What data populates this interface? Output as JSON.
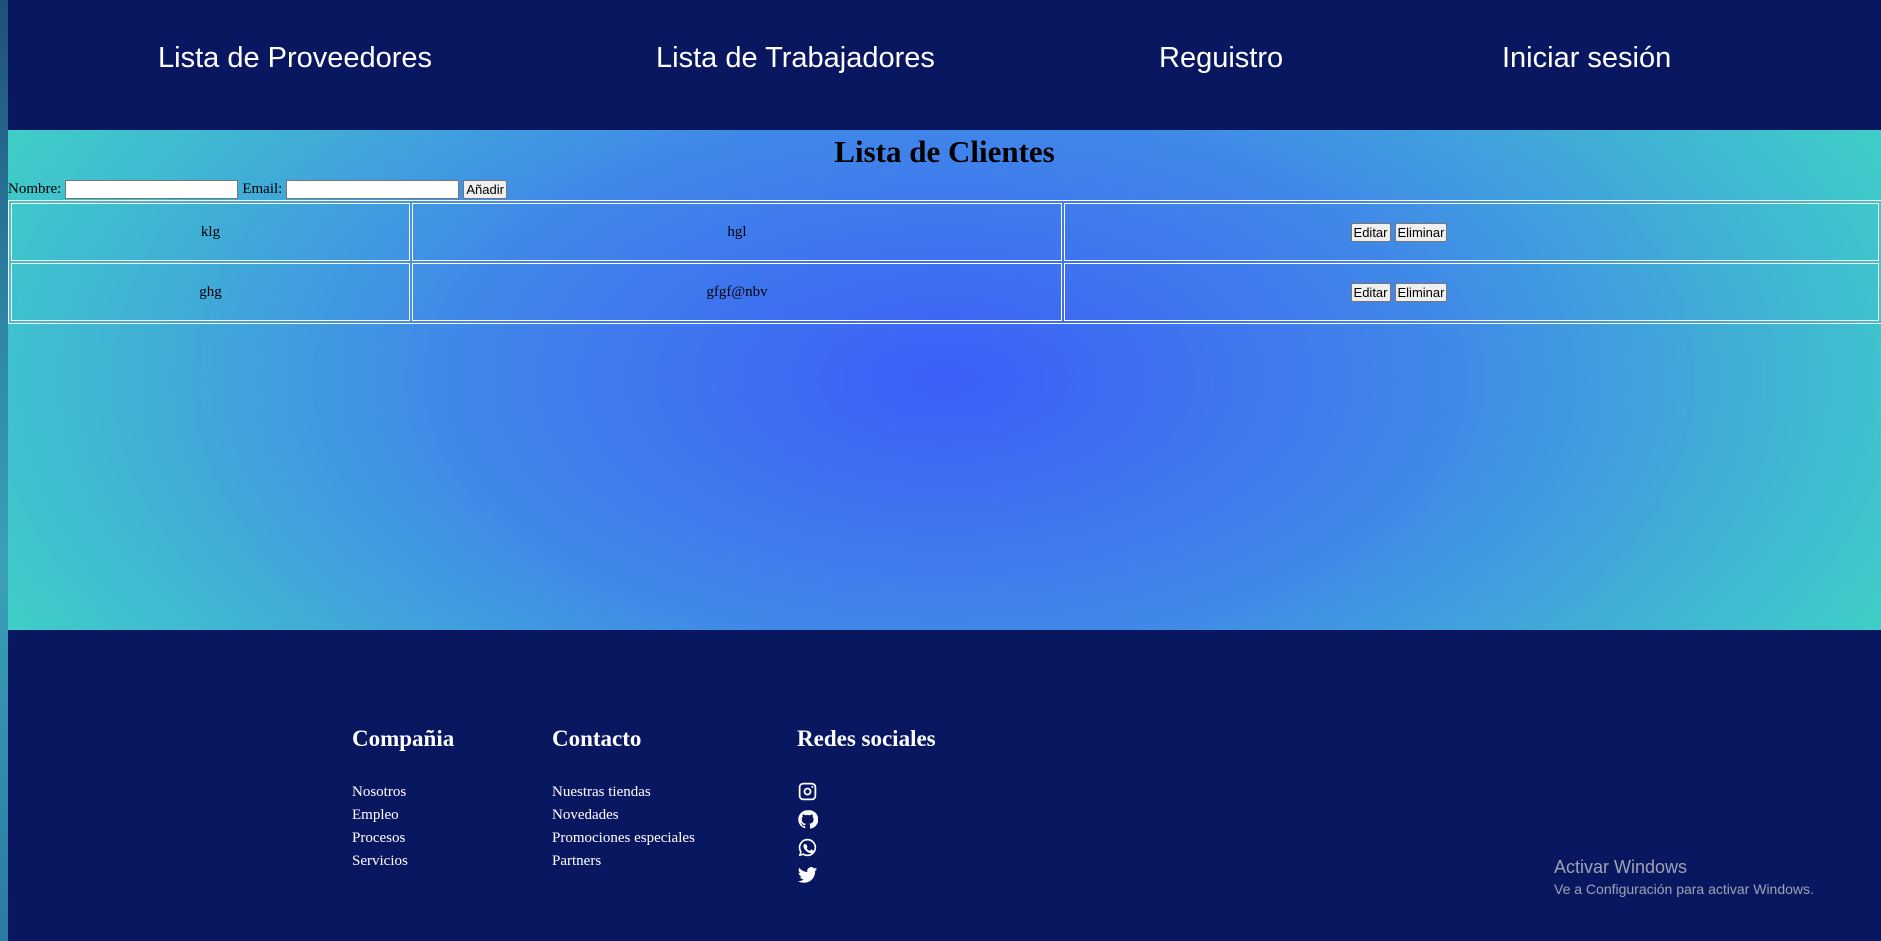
{
  "nav": {
    "items": [
      {
        "label": "Lista de Proveedores"
      },
      {
        "label": "Lista de Trabajadores"
      },
      {
        "label": "Reguistro"
      },
      {
        "label": "Iniciar sesión"
      }
    ]
  },
  "main": {
    "title": "Lista de Clientes",
    "form": {
      "nombre_label": "Nombre:",
      "nombre_value": "",
      "email_label": "Email:",
      "email_value": "",
      "add_label": "Añadir"
    },
    "rows": [
      {
        "nombre": "klg",
        "email": "hgl",
        "edit_label": "Editar",
        "delete_label": "Eliminar"
      },
      {
        "nombre": "ghg",
        "email": "gfgf@nbv",
        "edit_label": "Editar",
        "delete_label": "Eliminar"
      }
    ]
  },
  "footer": {
    "compania": {
      "heading": "Compañia",
      "links": [
        "Nosotros",
        "Empleo",
        "Procesos",
        "Servicios"
      ]
    },
    "contacto": {
      "heading": "Contacto",
      "links": [
        "Nuestras tiendas",
        "Novedades",
        "Promociones especiales",
        "Partners"
      ]
    },
    "redes": {
      "heading": "Redes sociales",
      "icons": [
        "instagram-icon",
        "github-icon",
        "whatsapp-icon",
        "twitter-icon"
      ]
    }
  },
  "watermark": {
    "line1": "Activar Windows",
    "line2": "Ve a Configuración para activar Windows."
  },
  "colors": {
    "nav_bg": "#091660",
    "accent_center": "#3d5ef8",
    "accent_edge": "#3fd9c2"
  }
}
